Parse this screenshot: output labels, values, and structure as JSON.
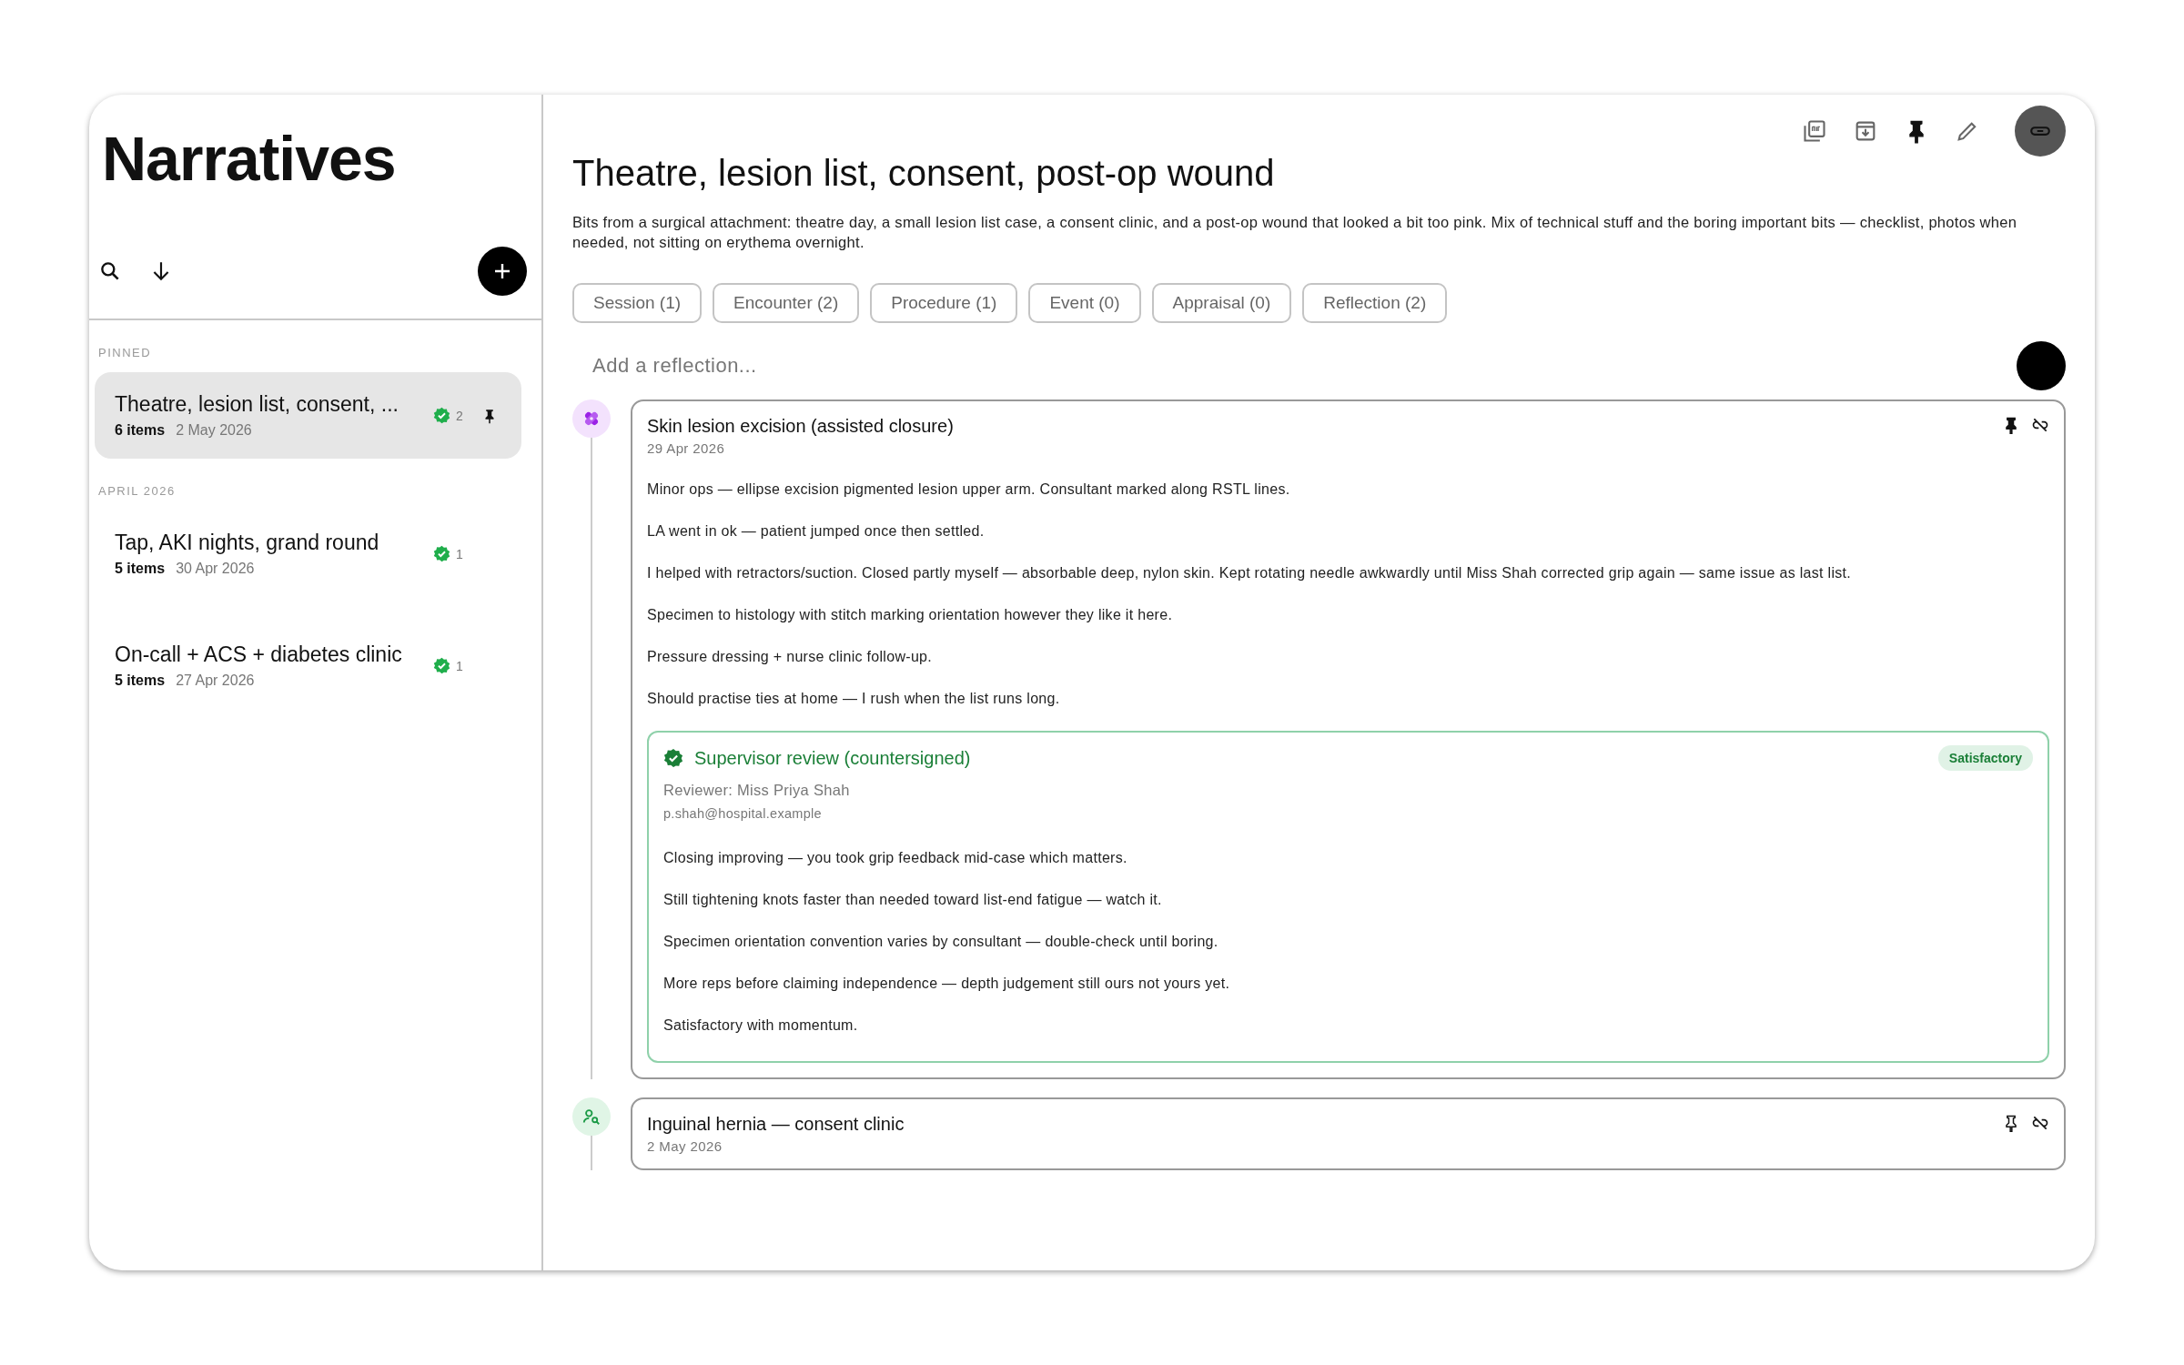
{
  "sidebar": {
    "title": "Narratives",
    "groups": [
      {
        "label": "PINNED",
        "items": [
          {
            "title": "Theatre, lesion list, consent, ...",
            "count": "6 items",
            "date": "2 May 2026",
            "verified": "2",
            "pinned": true,
            "selected": true
          }
        ]
      },
      {
        "label": "APRIL 2026",
        "items": [
          {
            "title": "Tap, AKI nights, grand round",
            "count": "5 items",
            "date": "30 Apr 2026",
            "verified": "1",
            "pinned": false,
            "selected": false
          },
          {
            "title": "On-call + ACS + diabetes clinic",
            "count": "5 items",
            "date": "27 Apr 2026",
            "verified": "1",
            "pinned": false,
            "selected": false
          }
        ]
      }
    ]
  },
  "narrative": {
    "pinned": true,
    "title": "Theatre, lesion list, consent, post-op wound",
    "description": "Bits from a surgical attachment: theatre day, a small lesion list case, a consent clinic, and a post-op wound that looked a bit too pink. Mix of technical stuff and the boring important bits — checklist, photos when needed, not sitting on erythema overnight.",
    "filters": [
      "Session (1)",
      "Encounter (2)",
      "Procedure (1)",
      "Event (0)",
      "Appraisal (0)",
      "Reflection (2)"
    ],
    "reflection": {
      "placeholder": "Add a reflection..."
    },
    "entries": [
      {
        "kind": "procedure",
        "title": "Skin lesion excision (assisted closure)",
        "date": "29 Apr 2026",
        "pinned": true,
        "paragraphs": [
          "Minor ops — ellipse excision pigmented lesion upper arm. Consultant marked along RSTL lines.",
          "LA went in ok — patient jumped once then settled.",
          "I helped with retractors/suction. Closed partly myself — absorbable deep, nylon skin. Kept rotating needle awkwardly until Miss Shah corrected grip again — same issue as last list.",
          "Specimen to histology with stitch marking orientation however they like it here.",
          "Pressure dressing + nurse clinic follow-up.",
          "Should practise ties at home — I rush when the list runs long."
        ],
        "review": {
          "title": "Supervisor review (countersigned)",
          "outcome": "Satisfactory",
          "reviewer": "Reviewer: Miss Priya Shah",
          "email": "p.shah@hospital.example",
          "paragraphs": [
            "Closing improving — you took grip feedback mid-case which matters.",
            "Still tightening knots faster than needed toward list-end fatigue — watch it.",
            "Specimen orientation convention varies by consultant — double-check until boring.",
            "More reps before claiming independence — depth judgement still ours not yours yet.",
            "Satisfactory with momentum."
          ]
        }
      },
      {
        "kind": "encounter",
        "title": "Inguinal hernia — consent clinic",
        "date": "2 May 2026",
        "pinned": false
      }
    ]
  }
}
